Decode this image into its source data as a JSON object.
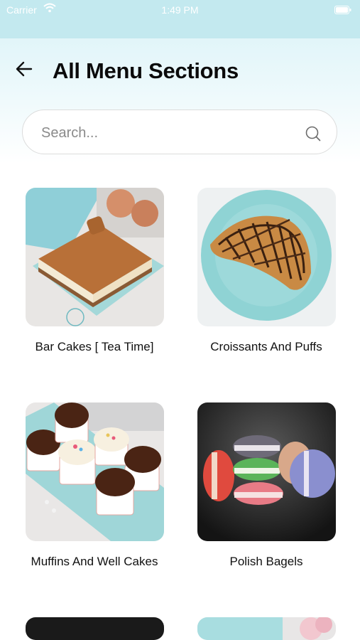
{
  "status_bar": {
    "carrier": "Carrier",
    "time": "1:49 PM"
  },
  "header": {
    "title": "All Menu Sections"
  },
  "search": {
    "placeholder": "Search..."
  },
  "sections": [
    {
      "label": "Bar Cakes [ Tea Time]",
      "icon": "bar-cake-photo"
    },
    {
      "label": "Croissants And Puffs",
      "icon": "croissant-photo"
    },
    {
      "label": "Muffins And Well Cakes",
      "icon": "cupcakes-photo"
    },
    {
      "label": "Polish Bagels",
      "icon": "macarons-photo"
    },
    {
      "label": "",
      "icon": "dark-photo"
    },
    {
      "label": "",
      "icon": "box-photo"
    }
  ],
  "colors": {
    "status_bar": "#c3e9ef",
    "header_gradient": "#d9f2f7",
    "title": "#0b0b0b"
  }
}
